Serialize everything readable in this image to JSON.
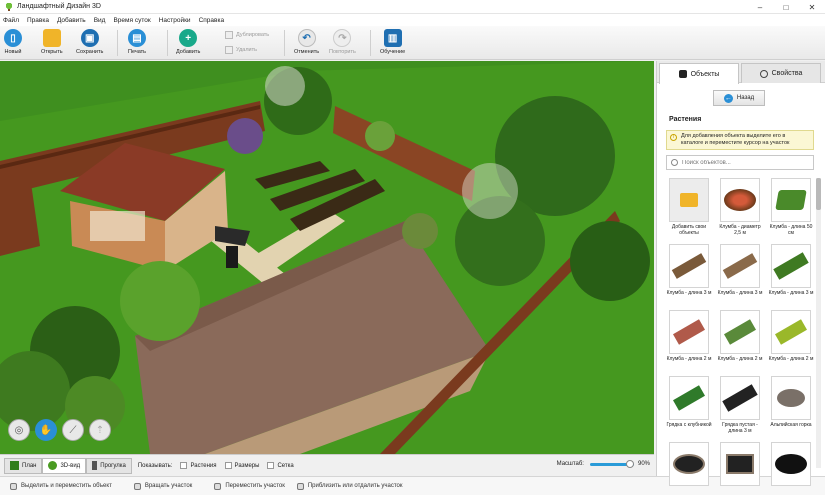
{
  "window": {
    "title": "Ландшафтный Дизайн 3D",
    "minimize": "–",
    "maximize": "□",
    "close": "✕"
  },
  "menu": [
    "Файл",
    "Правка",
    "Добавить",
    "Вид",
    "Время суток",
    "Настройки",
    "Справка"
  ],
  "toolbar": {
    "new": "Новый",
    "open": "Открыть",
    "save": "Сохранить",
    "print": "Печать",
    "add": "Добавить",
    "duplicate": "Дублировать",
    "delete": "Удалить",
    "undo": "Отменить",
    "redo": "Повторить",
    "tutorial": "Обучение"
  },
  "view_modes": {
    "plan": "План",
    "view3d": "3D-вид",
    "walk": "Прогулка"
  },
  "show": {
    "label": "Показывать:",
    "plants": "Растения",
    "sizes": "Размеры",
    "grid": "Сетка"
  },
  "zoom": {
    "label": "Масштаб:",
    "value": "90%",
    "level": 0.9
  },
  "hints": [
    "Выделить и переместить объект",
    "Вращать участок",
    "Переместить участок",
    "Приблизить или отдалить участок"
  ],
  "panel": {
    "tab_objects": "Объекты",
    "tab_properties": "Свойства",
    "back": "Назад",
    "section": "Растения",
    "info": "Для добавления объекта выделите его в каталоге и переместите курсор на участок",
    "search_placeholder": "Поиск объектов...",
    "items": [
      {
        "label": "Добавить свои объекты",
        "icon": "folder-plus-icon"
      },
      {
        "label": "Клумба - диаметр 2,5 м",
        "icon": "round-flowerbed-icon"
      },
      {
        "label": "Клумба - длина 50 см",
        "icon": "flowerbed-small-icon"
      },
      {
        "label": "Клумба - длина 3 м",
        "icon": "flowerbed-long-icon"
      },
      {
        "label": "Клумба - длина 3 м",
        "icon": "flowerbed-long-icon"
      },
      {
        "label": "Клумба - длина 3 м",
        "icon": "flowerbed-long-icon"
      },
      {
        "label": "Клумба - длина 2 м",
        "icon": "flowerbed-icon"
      },
      {
        "label": "Клумба - длина 2 м",
        "icon": "flowerbed-icon"
      },
      {
        "label": "Клумба - длина 2 м",
        "icon": "flowerbed-icon"
      },
      {
        "label": "Грядка с клубникой",
        "icon": "strawberry-bed-icon"
      },
      {
        "label": "Грядка пустая - длина 3 м",
        "icon": "empty-bed-icon"
      },
      {
        "label": "Альпийская горка",
        "icon": "rock-garden-icon"
      },
      {
        "label": "",
        "icon": "round-bed-icon"
      },
      {
        "label": "",
        "icon": "square-bed-icon"
      },
      {
        "label": "",
        "icon": "round-bed-icon"
      }
    ]
  }
}
